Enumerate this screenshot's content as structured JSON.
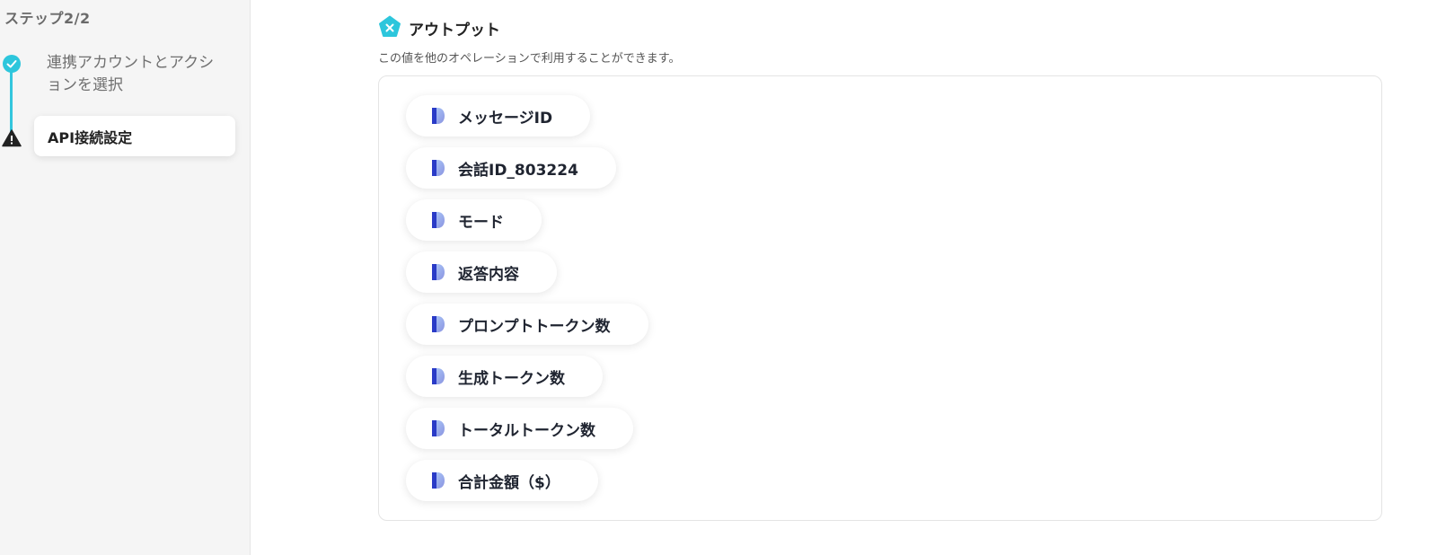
{
  "sidebar": {
    "step_title": "ステップ2/2",
    "steps": [
      {
        "label": "連携アカウントとアクションを選択",
        "status": "complete"
      },
      {
        "label": "API接続設定",
        "status": "warning"
      }
    ]
  },
  "output": {
    "title": "アウトプット",
    "description": "この値を他のオペレーションで利用することができます。",
    "items": [
      {
        "label": "メッセージID"
      },
      {
        "label": "会話ID_803224"
      },
      {
        "label": "モード"
      },
      {
        "label": "返答内容"
      },
      {
        "label": "プロンプトトークン数"
      },
      {
        "label": "生成トークン数"
      },
      {
        "label": "トータルトークン数"
      },
      {
        "label": "合計金額（$）"
      }
    ]
  },
  "colors": {
    "accent": "#2dc6dc",
    "chip_icon_top": "#5b8df0",
    "chip_icon_bottom": "#2a3bc7"
  }
}
